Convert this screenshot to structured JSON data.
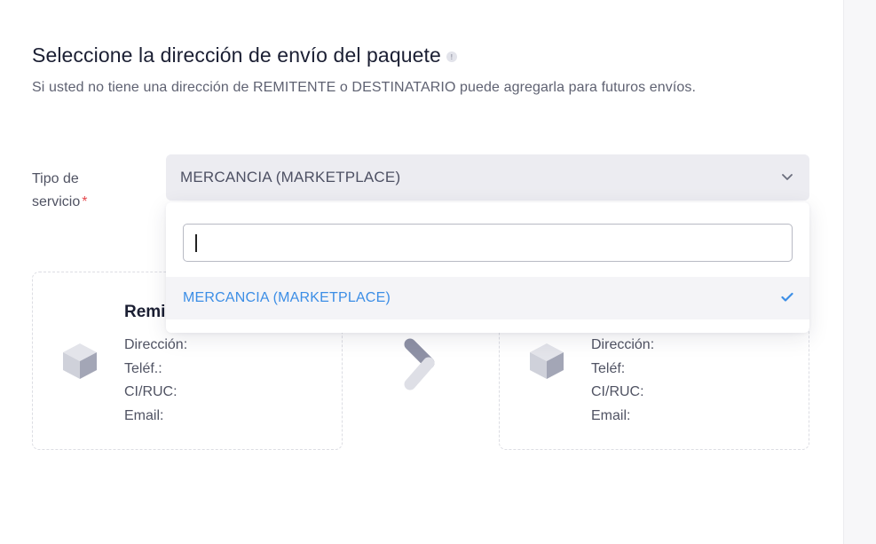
{
  "header": {
    "title": "Seleccione la dirección de envío del paquete",
    "subtitle": "Si usted no tiene una dirección de REMITENTE o DESTINATARIO puede agregarla para futuros envíos."
  },
  "service_type": {
    "label_line1": "Tipo de",
    "label_line2": "servicio",
    "required_mark": "*",
    "selected_value": "MERCANCIA (MARKETPLACE)",
    "search_value": "",
    "options": [
      {
        "label": "MERCANCIA (MARKETPLACE)",
        "selected": true
      }
    ]
  },
  "sender_card": {
    "title": "Remi",
    "fields": [
      "Dirección:",
      "Teléf.:",
      "CI/RUC:",
      "Email:"
    ]
  },
  "recipient_card": {
    "fields": [
      "Dirección:",
      "Teléf:",
      "CI/RUC:",
      "Email:"
    ]
  },
  "colors": {
    "accent": "#3c8ee6",
    "required": "#e5484d",
    "select_bg": "#ececf1"
  }
}
